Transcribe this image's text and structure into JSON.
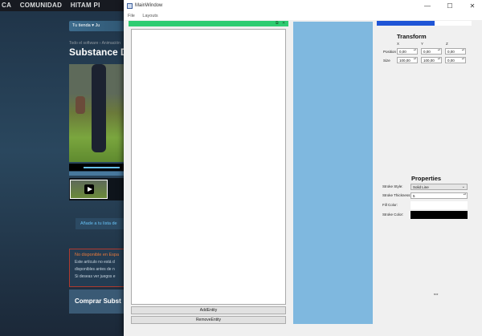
{
  "steam": {
    "nav_items": [
      "CA",
      "COMUNIDAD",
      "HITAM PI"
    ],
    "store_menu": "Tu tienda ▾   Ju",
    "breadcrumb": "Todo el software › Animación",
    "game_title": "Substance De",
    "wishlist_button": "Añade a tu lista de",
    "notice_title": "No disponible en Espa",
    "notice_lines": [
      "Este artículo no está d",
      "disponibles antes de n",
      "Si deseas ver juegos e"
    ],
    "buy_title": "Comprar Subst"
  },
  "window": {
    "title": "MainWindow",
    "controls": {
      "minimize": "—",
      "maximize": "☐",
      "close": "✕"
    },
    "menu": [
      "File",
      "Layouts"
    ]
  },
  "left_dock": {
    "icons": {
      "float": "⧉",
      "close": "✕"
    },
    "add_entity_label": "AddEntity",
    "remove_entity_label": "RemoveEntity"
  },
  "transform": {
    "title": "Transform",
    "axes": [
      "X",
      "Y",
      "Z"
    ],
    "position": {
      "label": "Position",
      "x": "0,00",
      "y": "0,00",
      "z": "0,00"
    },
    "size": {
      "label": "Size",
      "x": "100,00",
      "y": "100,00",
      "z": "0,00"
    }
  },
  "properties": {
    "title": "Properties",
    "stroke_style_label": "Stroke Style:",
    "stroke_style_value": "Solid Line",
    "stroke_thickness_label": "Stroke Thickness:",
    "stroke_thickness_value": "5",
    "fill_color_label": "Fill Color:",
    "fill_color": "#ffffff",
    "stroke_color_label": "Stroke Color:",
    "stroke_color": "#000000"
  },
  "colors": {
    "left_dock_title": "#2ecc71",
    "right_dock_title": "#1f55d6",
    "viewport": "#7fb8df"
  }
}
